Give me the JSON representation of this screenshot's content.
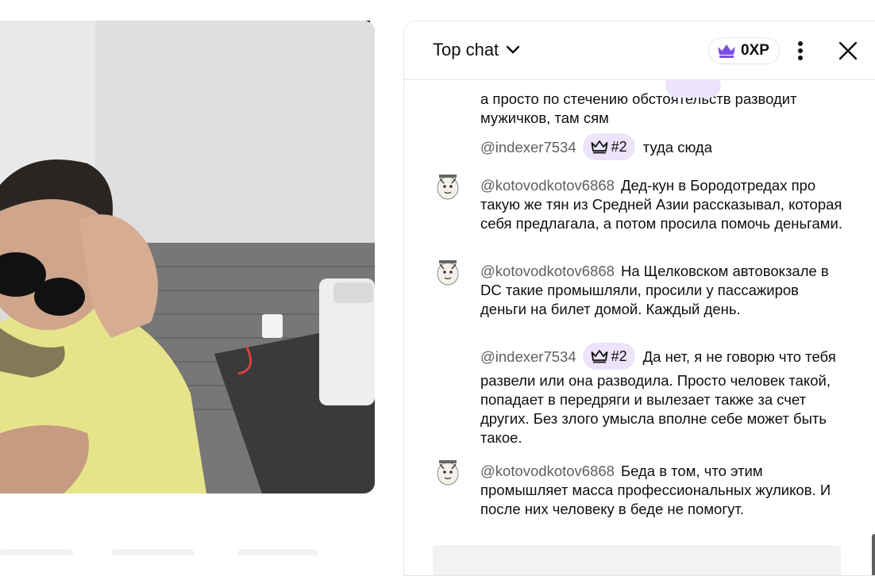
{
  "chat": {
    "title": "Top chat",
    "xp": "0XP",
    "messages": [
      {
        "author": "",
        "badge": "",
        "text": "а просто по стечению обстоятельств разводит мужичков, там сям"
      },
      {
        "author": "@indexer7534",
        "badge": "#2",
        "text": "туда сюда"
      },
      {
        "author": "@kotovodkotov6868",
        "badge": "",
        "text": "Дед-кун в Бородотредах про такую же тян из Средней Азии рассказывал, которая себя предлагала, а потом просила помочь деньгами."
      },
      {
        "author": "@kotovodkotov6868",
        "badge": "",
        "text": "На Щелковском автовокзале в DC такие промышляли, просили у пассажиров деньги на билет домой. Каждый день."
      },
      {
        "author": "@indexer7534",
        "badge": "#2",
        "text": "Да нет, я не говорю что тебя развели или она разводила. Просто человек такой, попадает в передряги и вылезает также за счет других. Без злого умысла вполне себе может быть такое."
      },
      {
        "author": "@kotovodkotov6868",
        "badge": "",
        "text": "Беда в том, что этим промышляет масса профессиональных жуликов. И после них человеку в беде не помогут."
      }
    ]
  },
  "colors": {
    "accent_purple": "#7b4fe0",
    "badge_bg": "#ece4fb",
    "author_gray": "#606060"
  },
  "icons": {
    "dropdown": "chevron-down-icon",
    "crown": "crown-icon",
    "more": "more-vert-icon",
    "close": "close-icon"
  }
}
